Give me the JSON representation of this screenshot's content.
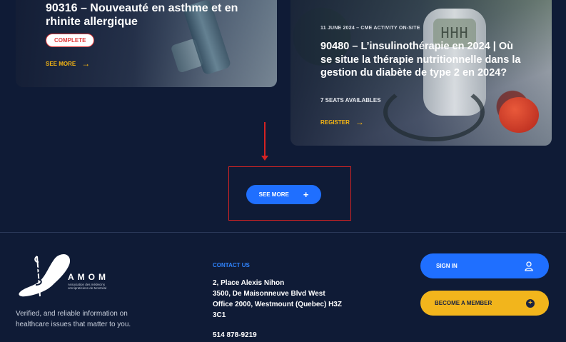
{
  "cards": [
    {
      "title": "90316 – Nouveauté en asthme et en rhinite allergique",
      "badge": "COMPLETE",
      "link_label": "SEE MORE",
      "arrow": "→"
    },
    {
      "meta": "11 JUNE 2024 – CME ACTIVITY ON-SITE",
      "title": "90480 – L’insulinothérapie en 2024 | Où se situe la thérapie nutritionnelle dans la gestion du diabète de type 2 en 2024?",
      "seats": "7 SEATS AVAILABLES",
      "link_label": "REGISTER",
      "arrow": "→",
      "meter_reading": "HHH"
    }
  ],
  "see_more_button": {
    "label": "SEE MORE",
    "icon": "+"
  },
  "footer": {
    "logo": {
      "name": "AMOM",
      "subtitle": "Association des médecins omnipraticiens de Montréal"
    },
    "tagline": "Verified, and reliable information on healthcare issues that matter to you.",
    "contact": {
      "title": "CONTACT US",
      "lines": [
        "2, Place Alexis Nihon",
        "3500, De Maisonneuve Blvd West",
        "Office 2000, Westmount (Quebec) H3Z",
        "3C1",
        "514 878-9219"
      ]
    },
    "sign_in_label": "SIGN IN",
    "become_member_label": "BECOME A MEMBER"
  },
  "colors": {
    "background": "#0f1b36",
    "primary_blue": "#1f6fff",
    "accent_yellow": "#f2b51c",
    "annotation_red": "#d42323",
    "badge_red": "#e03a3a"
  }
}
